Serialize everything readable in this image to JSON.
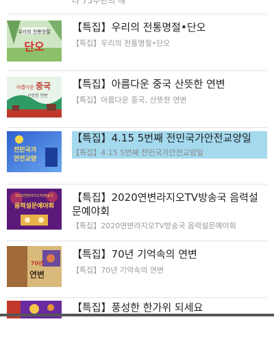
{
  "top_partial": {
    "subtitle": "다 75주년의 해"
  },
  "items": [
    {
      "title": "【특집】우리의 전통명절•단오",
      "subtitle": "【특집】우리의 전통명절•단오",
      "thumb_icon": "dano-festival-thumbnail",
      "thumb_text": "단오"
    },
    {
      "title": "【특집】아름다운 중국 산뜻한 연변",
      "subtitle": "【특집】아름다운 중국, 산뜻한 연변",
      "thumb_icon": "beautiful-china-thumbnail",
      "thumb_text": "중국"
    },
    {
      "title": "【특집】4.15 5번째 전민국가안전교양일",
      "subtitle": "【특집】4.15 5번째 전민국가안전교양일",
      "thumb_icon": "national-security-thumbnail",
      "thumb_text": "전민국가 안전교양"
    },
    {
      "title": "【특집】2020연변라지오TV방송국 음력설문예야회",
      "subtitle": "【특집】2020연변라지오TV방송국 음력설문예야회",
      "thumb_icon": "new-year-gala-thumbnail",
      "thumb_text": "음력설문예야회"
    },
    {
      "title": "【특집】70년 기억속의 연변",
      "subtitle": "【특집】70년 기억속의 연변",
      "thumb_icon": "yanbian-70-thumbnail",
      "thumb_text": "연변"
    },
    {
      "title": "【특집】풍성한 한가위 되세요",
      "subtitle": "",
      "thumb_icon": "chuseok-thumbnail",
      "thumb_text": ""
    }
  ]
}
